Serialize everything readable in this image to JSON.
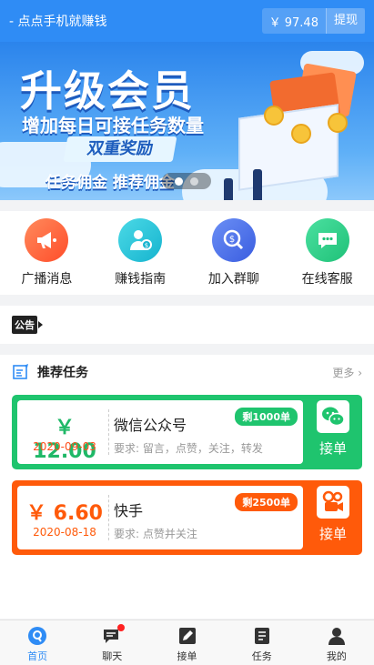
{
  "header": {
    "title": "- 点点手机就赚钱",
    "balance": "￥ 97.48",
    "withdraw_label": "提现"
  },
  "banner": {
    "title": "升级会员",
    "subtitle": "增加每日可接任务数量",
    "pill": "双重奖励",
    "footer": "任务佣金  推荐佣金",
    "slides": 2,
    "active_slide": 1
  },
  "quick_menu": [
    {
      "label": "广播消息",
      "icon": "megaphone-icon",
      "color": "#ff6a3d"
    },
    {
      "label": "赚钱指南",
      "icon": "money-guide-icon",
      "color": "#27c6d8"
    },
    {
      "label": "加入群聊",
      "icon": "join-group-icon",
      "color": "#4a7df0"
    },
    {
      "label": "在线客服",
      "icon": "chat-service-icon",
      "color": "#2fd08a"
    }
  ],
  "notice": {
    "tag": "公告"
  },
  "tasks": {
    "title": "推荐任务",
    "more_label": "更多 ›",
    "items": [
      {
        "price": "￥ 12.00",
        "date": "2020-09-03",
        "name": "微信公众号",
        "requirement": "要求: 留言，点赞，关注，转发",
        "remaining": "剩1000单",
        "action": "接单",
        "icon": "wechat-icon",
        "color": "#1fc46e"
      },
      {
        "price": "￥ 6.60",
        "date": "2020-08-18",
        "name": "快手",
        "requirement": "要求: 点赞并关注",
        "remaining": "剩2500单",
        "action": "接单",
        "icon": "kuaishou-icon",
        "color": "#ff5a0a"
      }
    ]
  },
  "tabbar": [
    {
      "label": "首页",
      "icon": "home-icon",
      "active": true
    },
    {
      "label": "聊天",
      "icon": "chat-icon",
      "badge": true
    },
    {
      "label": "接单",
      "icon": "pen-icon"
    },
    {
      "label": "任务",
      "icon": "task-list-icon"
    },
    {
      "label": "我的",
      "icon": "user-icon"
    }
  ]
}
